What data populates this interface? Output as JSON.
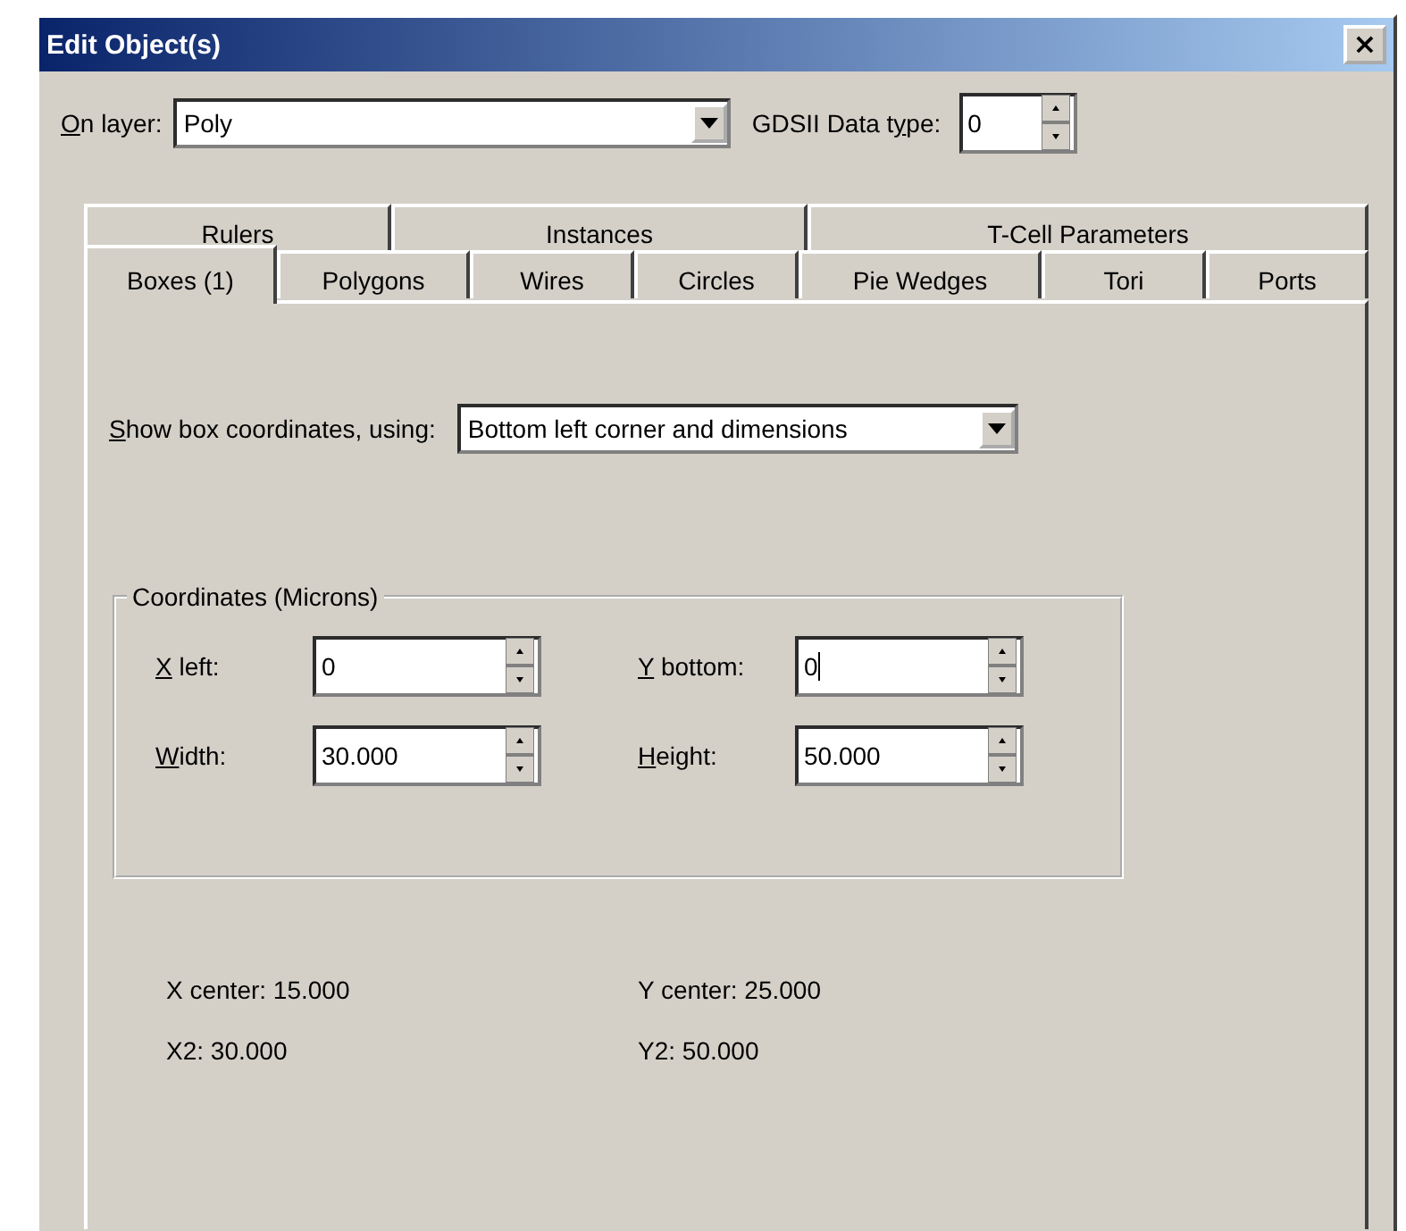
{
  "window": {
    "title": "Edit Object(s)",
    "close": "×"
  },
  "layer": {
    "label": {
      "key": "O",
      "after": "n layer:"
    },
    "value": "Poly"
  },
  "datatype": {
    "label": {
      "before": "GDSII Data t",
      "key": "y",
      "after": "pe:"
    },
    "value": "0"
  },
  "tab_rows": [
    [
      {
        "label": "Rulers",
        "selected": false
      },
      {
        "label": "Instances",
        "selected": false
      },
      {
        "label": "T-Cell Parameters",
        "selected": false
      }
    ],
    [
      {
        "label": "Boxes (1)",
        "selected": true
      },
      {
        "label": "Polygons",
        "selected": false
      },
      {
        "label": "Wires",
        "selected": false
      },
      {
        "label": "Circles",
        "selected": false
      },
      {
        "label": "Pie Wedges",
        "selected": false
      },
      {
        "label": "Tori",
        "selected": false
      },
      {
        "label": "Ports",
        "selected": false
      }
    ]
  ],
  "show_coords": {
    "label": {
      "key": "S",
      "after": "how box coordinates, using:"
    },
    "value": "Bottom left corner and dimensions"
  },
  "coordinates": {
    "title": "Coordinates (Microns)",
    "fields": [
      {
        "label": {
          "key": "X",
          "after": " left:"
        },
        "value": "0",
        "focused": false
      },
      {
        "label": {
          "key": "Y",
          "after": " bottom:"
        },
        "value": "0",
        "focused": true
      },
      {
        "label": {
          "key": "W",
          "after": "idth:"
        },
        "value": "30.000",
        "focused": false
      },
      {
        "label": {
          "key": "H",
          "after": "eight:"
        },
        "value": "50.000",
        "focused": false
      }
    ]
  },
  "readouts": [
    "X center: 15.000",
    "Y center: 25.000",
    "X2: 30.000",
    "Y2: 50.000"
  ]
}
